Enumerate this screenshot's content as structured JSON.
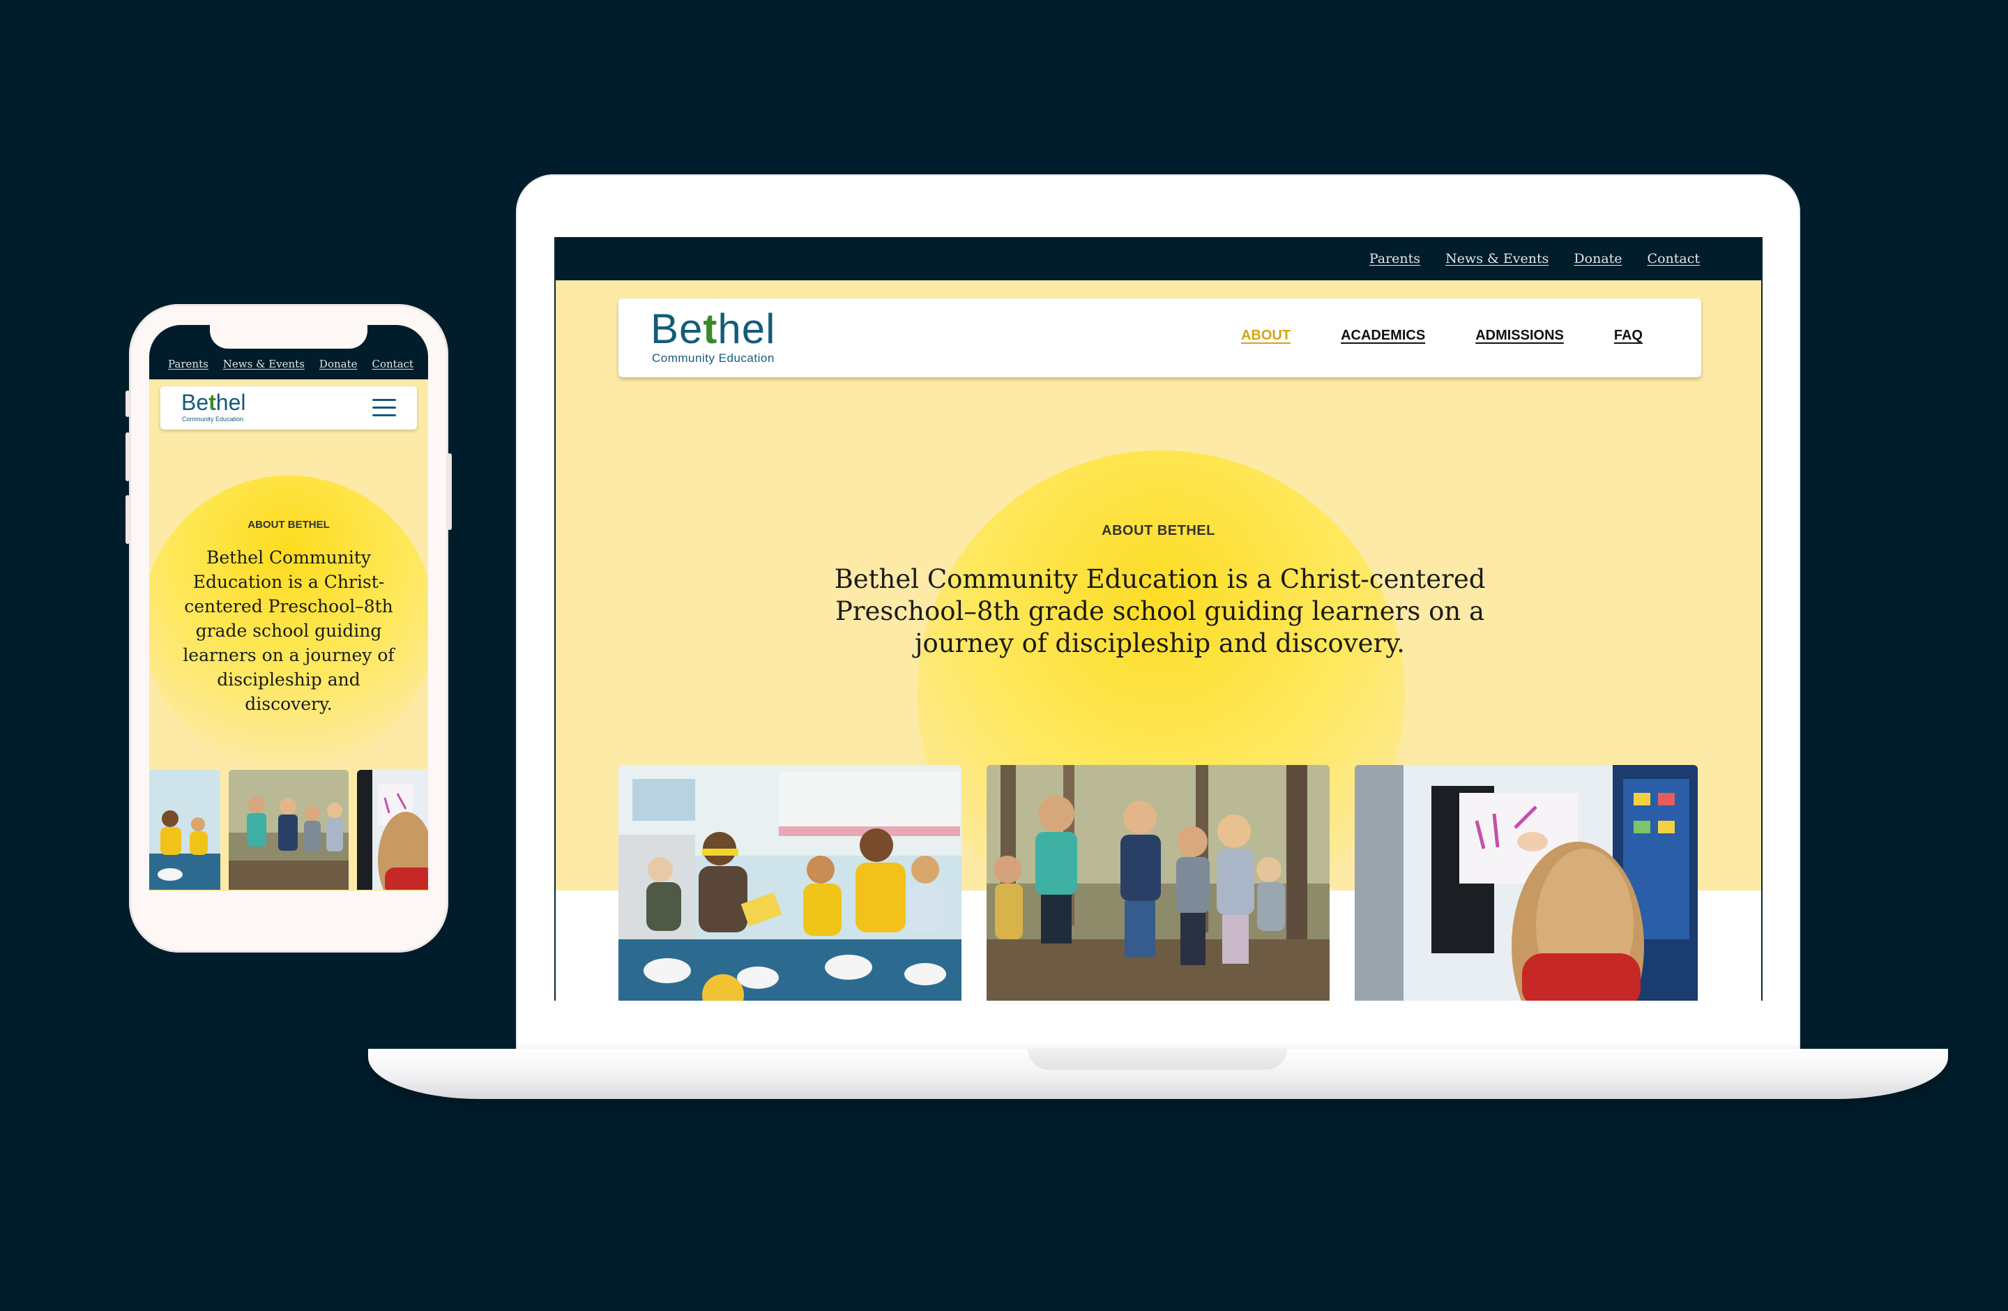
{
  "top_links": [
    "Parents",
    "News & Events",
    "Donate",
    "Contact"
  ],
  "brand": {
    "name_pre": "Be",
    "name_cross": "t",
    "name_post": "hel",
    "tagline": "Community Education"
  },
  "nav": [
    "ABOUT",
    "ACADEMICS",
    "ADMISSIONS",
    "FAQ"
  ],
  "nav_active": "ABOUT",
  "hero": {
    "eyebrow": "ABOUT BETHEL",
    "headline": "Bethel Community Education is a Christ-centered Preschool–8th grade school guiding learners on a journey of discipleship and discovery."
  },
  "photos": [
    "classroom-reading-photo",
    "forest-walk-photo",
    "whiteboard-writing-photo"
  ],
  "colors": {
    "page_bg": "#011d2b",
    "hero_bg": "#fdeaa6",
    "sun": "#fddc1e",
    "accent": "#d4a515",
    "brand": "#145b7a"
  }
}
